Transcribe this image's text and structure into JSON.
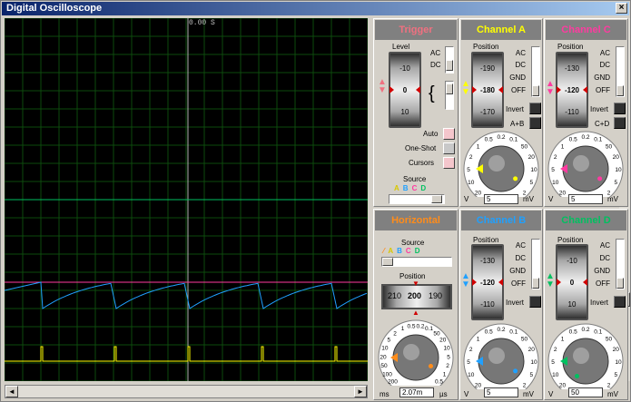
{
  "window": {
    "title": "Digital Oscilloscope",
    "close": "×"
  },
  "screen": {
    "time_label": "0.00 S"
  },
  "scroll": {
    "left": "◄",
    "right": "►"
  },
  "colors": {
    "A": "#ffff00",
    "B": "#1fa0ff",
    "C": "#ff3aa0",
    "D": "#00c060",
    "trigger": "#f07080",
    "horizontal": "#ff8c1a"
  },
  "trigger": {
    "title": "Trigger",
    "level_label": "Level",
    "level_values": [
      "-10",
      "0",
      "10"
    ],
    "ac": "AC",
    "dc": "DC",
    "auto": "Auto",
    "one_shot": "One-Shot",
    "cursors": "Cursors",
    "source_label": "Source",
    "source_letters": [
      "A",
      "B",
      "C",
      "D"
    ]
  },
  "channel_a": {
    "title": "Channel A",
    "position_label": "Position",
    "values": [
      "-190",
      "-180",
      "-170"
    ],
    "modes": [
      "AC",
      "DC",
      "GND",
      "OFF"
    ],
    "invert": "Invert",
    "combine": "A+B",
    "dial": [
      "0.2",
      "0.5",
      "1",
      "2",
      "5",
      "10",
      "20",
      "50",
      "0.1",
      "50",
      "20",
      "10",
      "5",
      "2",
      "20",
      "5"
    ],
    "v_label": "V",
    "value": "5",
    "mv_label": "mV"
  },
  "channel_c": {
    "title": "Channel C",
    "position_label": "Position",
    "values": [
      "-130",
      "-120",
      "-110"
    ],
    "modes": [
      "AC",
      "DC",
      "GND",
      "OFF"
    ],
    "invert": "Invert",
    "combine": "C+D",
    "v_label": "V",
    "value": "5",
    "mv_label": "mV"
  },
  "horizontal": {
    "title": "Horizontal",
    "source_label": "Source",
    "source_letters": [
      "A",
      "B",
      "C",
      "D"
    ],
    "position_label": "Position",
    "values": [
      "210",
      "200",
      "190"
    ],
    "ms_label": "ms",
    "value": "2.07m",
    "us_label": "µs"
  },
  "channel_b": {
    "title": "Channel B",
    "position_label": "Position",
    "values": [
      "-130",
      "-120",
      "-110"
    ],
    "modes": [
      "AC",
      "DC",
      "GND",
      "OFF"
    ],
    "invert": "Invert",
    "v_label": "V",
    "value": "5",
    "mv_label": "mV"
  },
  "channel_d": {
    "title": "Channel D",
    "position_label": "Position",
    "values": [
      "-10",
      "0",
      "10"
    ],
    "modes": [
      "AC",
      "DC",
      "GND",
      "OFF"
    ],
    "invert": "Invert",
    "v_label": "V",
    "value": "50",
    "mv_label": "mV"
  },
  "dial_labels": {
    "volts": [
      "20",
      "10",
      "5",
      "2",
      "1",
      "0.5",
      "0.2",
      "0.1",
      "50",
      "20",
      "10",
      "5",
      "2"
    ],
    "time": [
      "200",
      "100",
      "50",
      "20",
      "10",
      "5",
      "2",
      "1",
      "0.5",
      "0.2",
      "0.1",
      "50",
      "20",
      "10",
      "5",
      "2",
      "1",
      "0.5"
    ]
  }
}
